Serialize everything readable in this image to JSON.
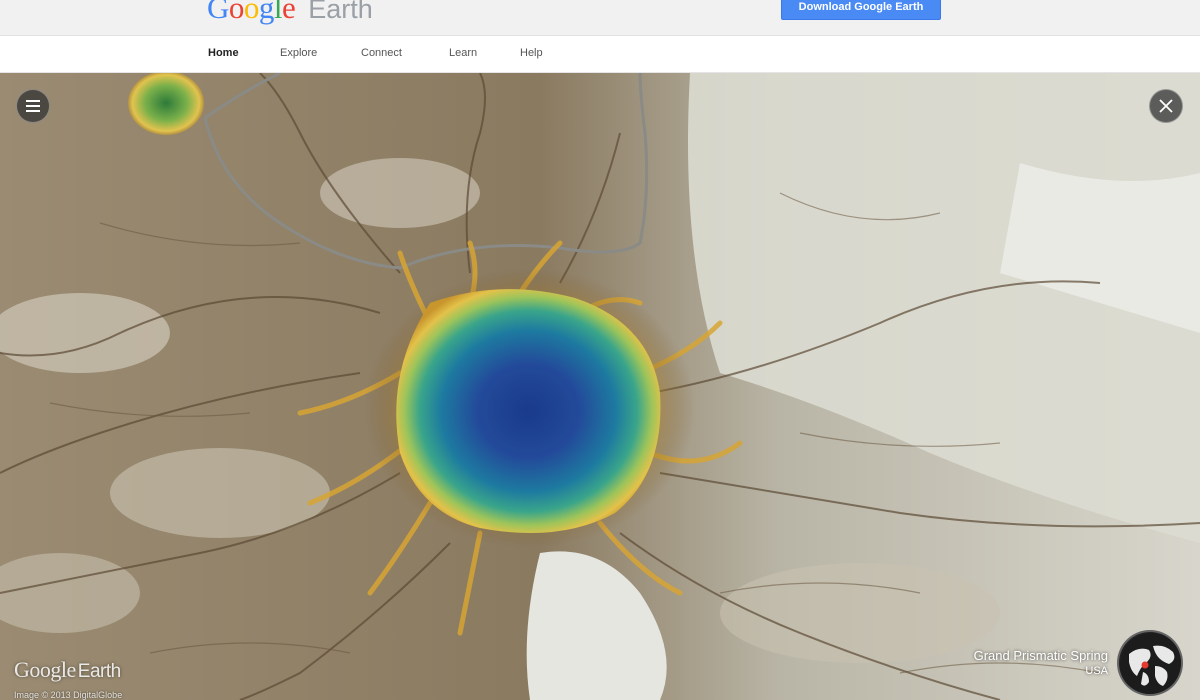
{
  "header": {
    "brand_letters": [
      {
        "char": "G",
        "color": "#4285f4"
      },
      {
        "char": "o",
        "color": "#ea4335"
      },
      {
        "char": "o",
        "color": "#fbbc05"
      },
      {
        "char": "g",
        "color": "#4285f4"
      },
      {
        "char": "l",
        "color": "#34a853"
      },
      {
        "char": "e",
        "color": "#ea4335"
      }
    ],
    "product_name": "Earth",
    "download_label": "Download Google Earth",
    "download_color": "#4a8af4"
  },
  "nav": {
    "items": [
      {
        "label": "Home",
        "active": true
      },
      {
        "label": "Explore",
        "active": false
      },
      {
        "label": "Connect",
        "active": false
      },
      {
        "label": "Learn",
        "active": false
      },
      {
        "label": "Help",
        "active": false
      }
    ]
  },
  "map": {
    "menu_icon": "hamburger-menu-icon",
    "close_icon": "close-icon",
    "watermark_google": "Google",
    "watermark_earth": "Earth",
    "credit": "Image © 2013 DigitalGlobe",
    "place_name": "Grand Prismatic Spring",
    "place_country": "USA",
    "globe_icon": "globe-icon"
  }
}
